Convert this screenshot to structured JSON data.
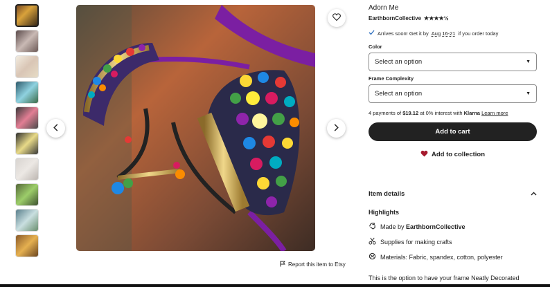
{
  "gallery": {
    "thumbnails": [
      "t1",
      "t2",
      "t3",
      "t4",
      "t5",
      "t6",
      "t7",
      "t8",
      "t9",
      "t10"
    ],
    "active_index": 0
  },
  "report_label": "Report this item to Etsy",
  "listing": {
    "title": "Adorn Me",
    "shop_name": "EarthbornCollective",
    "rating_stars": "★★★★½",
    "arrives_prefix": "Arrives soon! Get it by",
    "arrives_date": "Aug 16-21",
    "arrives_suffix": "if you order today"
  },
  "options": {
    "color_label": "Color",
    "color_value": "Select an option",
    "frame_label": "Frame Complexity",
    "frame_value": "Select an option"
  },
  "payment": {
    "prefix": "4 payments of",
    "amount": "$19.12",
    "middle": "at 0% interest with",
    "provider": "Klarna",
    "learn_more": "Learn more"
  },
  "actions": {
    "add_to_cart": "Add to cart",
    "add_to_collection": "Add to collection"
  },
  "details": {
    "heading": "Item details",
    "highlights_heading": "Highlights",
    "made_by_prefix": "Made by",
    "made_by_shop": "EarthbornCollective",
    "supplies": "Supplies for making crafts",
    "materials": "Materials: Fabric, spandex, cotton, polyester",
    "description": "This is the option to have your frame Neatly Decorated"
  },
  "colors": {
    "primary_button": "#222222",
    "heart": "#a61a2e"
  }
}
